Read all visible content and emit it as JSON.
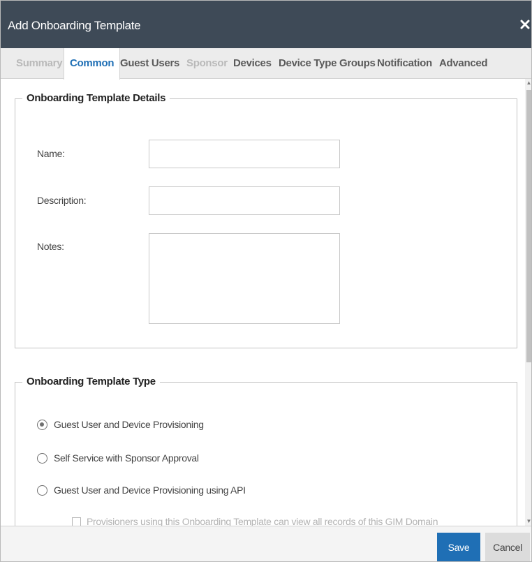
{
  "dialog": {
    "title": "Add Onboarding Template"
  },
  "tabs": [
    {
      "label": "Summary",
      "state": "disabled"
    },
    {
      "label": "Common",
      "state": "active"
    },
    {
      "label": "Guest Users",
      "state": "normal"
    },
    {
      "label": "Sponsor",
      "state": "disabled"
    },
    {
      "label": "Devices",
      "state": "normal"
    },
    {
      "label": "Device Type Groups",
      "state": "normal"
    },
    {
      "label": "Notification",
      "state": "normal"
    },
    {
      "label": "Advanced",
      "state": "normal"
    }
  ],
  "details": {
    "legend": "Onboarding Template Details",
    "name_label": "Name:",
    "name_value": "",
    "description_label": "Description:",
    "description_value": "",
    "notes_label": "Notes:",
    "notes_value": ""
  },
  "type": {
    "legend": "Onboarding Template Type",
    "options": [
      {
        "label": "Guest User and Device Provisioning",
        "checked": true
      },
      {
        "label": "Self Service with Sponsor Approval",
        "checked": false
      },
      {
        "label": "Guest User and Device Provisioning using API",
        "checked": false
      }
    ],
    "provisioners_checkbox_label": "Provisioners using this Onboarding Template can view all records of this GIM Domain",
    "provisioners_checkbox_checked": false,
    "provisioners_checkbox_enabled": false
  },
  "footer": {
    "save_label": "Save",
    "cancel_label": "Cancel"
  },
  "colors": {
    "titlebar": "#3e4a57",
    "accent": "#1f6fb5",
    "tab_disabled": "#b9b9b9"
  },
  "icons": {
    "close": "close-icon",
    "scroll_up": "arrow-up-icon",
    "scroll_down": "arrow-down-icon"
  }
}
